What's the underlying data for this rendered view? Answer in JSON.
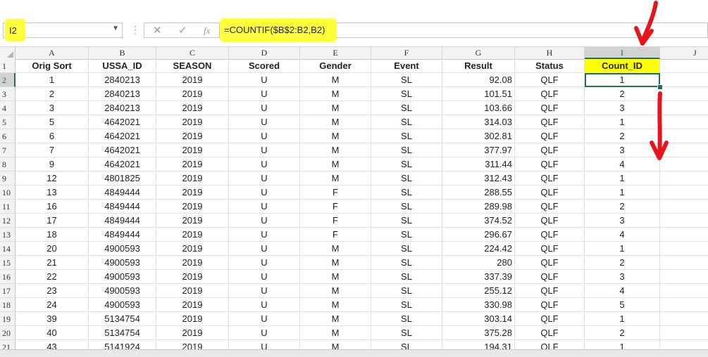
{
  "formula_bar": {
    "name_box": "I2",
    "cancel_icon": "✕",
    "enter_icon": "✓",
    "fx_label": "fx",
    "formula": "=COUNTIF($B$2:B2,B2)"
  },
  "sheet": {
    "columns": [
      "A",
      "B",
      "C",
      "D",
      "E",
      "F",
      "G",
      "H",
      "I",
      "J"
    ],
    "header_row": [
      "Orig Sort",
      "USSA_ID",
      "SEASON",
      "Scored",
      "Gender",
      "Event",
      "Result",
      "Status",
      "Count_ID"
    ],
    "rows": [
      [
        "1",
        "2840213",
        "2019",
        "U",
        "M",
        "SL",
        "92.08",
        "QLF",
        "1"
      ],
      [
        "2",
        "2840213",
        "2019",
        "U",
        "M",
        "SL",
        "101.51",
        "QLF",
        "2"
      ],
      [
        "3",
        "2840213",
        "2019",
        "U",
        "M",
        "SL",
        "103.66",
        "QLF",
        "3"
      ],
      [
        "5",
        "4642021",
        "2019",
        "U",
        "M",
        "SL",
        "314.03",
        "QLF",
        "1"
      ],
      [
        "6",
        "4642021",
        "2019",
        "U",
        "M",
        "SL",
        "302.81",
        "QLF",
        "2"
      ],
      [
        "7",
        "4642021",
        "2019",
        "U",
        "M",
        "SL",
        "377.97",
        "QLF",
        "3"
      ],
      [
        "9",
        "4642021",
        "2019",
        "U",
        "M",
        "SL",
        "311.44",
        "QLF",
        "4"
      ],
      [
        "12",
        "4801825",
        "2019",
        "U",
        "M",
        "SL",
        "312.43",
        "QLF",
        "1"
      ],
      [
        "13",
        "4849444",
        "2019",
        "U",
        "F",
        "SL",
        "288.55",
        "QLF",
        "1"
      ],
      [
        "16",
        "4849444",
        "2019",
        "U",
        "F",
        "SL",
        "289.98",
        "QLF",
        "2"
      ],
      [
        "17",
        "4849444",
        "2019",
        "U",
        "F",
        "SL",
        "374.52",
        "QLF",
        "3"
      ],
      [
        "18",
        "4849444",
        "2019",
        "U",
        "F",
        "SL",
        "296.67",
        "QLF",
        "4"
      ],
      [
        "20",
        "4900593",
        "2019",
        "U",
        "M",
        "SL",
        "224.42",
        "QLF",
        "1"
      ],
      [
        "21",
        "4900593",
        "2019",
        "U",
        "M",
        "SL",
        "280",
        "QLF",
        "2"
      ],
      [
        "22",
        "4900593",
        "2019",
        "U",
        "M",
        "SL",
        "337.39",
        "QLF",
        "3"
      ],
      [
        "23",
        "4900593",
        "2019",
        "U",
        "M",
        "SL",
        "255.12",
        "QLF",
        "4"
      ],
      [
        "24",
        "4900593",
        "2019",
        "U",
        "M",
        "SL",
        "330.98",
        "QLF",
        "5"
      ],
      [
        "39",
        "5134754",
        "2019",
        "U",
        "M",
        "SL",
        "303.14",
        "QLF",
        "1"
      ],
      [
        "40",
        "5134754",
        "2019",
        "U",
        "M",
        "SL",
        "375.28",
        "QLF",
        "2"
      ],
      [
        "43",
        "5141924",
        "2019",
        "U",
        "M",
        "SL",
        "194.31",
        "QLF",
        "1"
      ]
    ],
    "highlight_color": "#ffff00",
    "selection_color": "#217346",
    "annotation_color": "#e8141c"
  }
}
